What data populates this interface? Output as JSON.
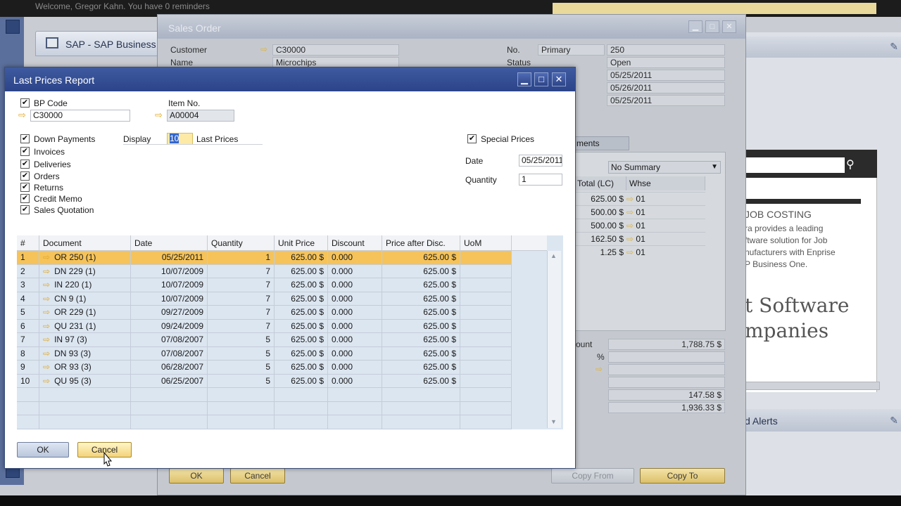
{
  "background": {
    "greeting": "Welcome, Gregor Kahn. You have 0 reminders",
    "main_window_title": "SAP - SAP Business One",
    "ad": {
      "heading": "JOB COSTING",
      "lines": [
        "ra provides a leading",
        "ftware solution for Job",
        "nufacturers with Enprise",
        "P Business One."
      ],
      "big_lines": [
        "t Software",
        "mpanies"
      ]
    },
    "alerts_title": "d Alerts"
  },
  "sales_order": {
    "title": "Sales Order",
    "customer_label": "Customer",
    "customer_value": "C30000",
    "name_label": "Name",
    "name_value": "Microchips",
    "no_label": "No.",
    "no_series": "Primary",
    "no_value": "250",
    "status_label": "Status",
    "status_value": "Open",
    "dates": [
      "05/25/2011",
      "05/26/2011",
      "05/25/2011"
    ],
    "tab_label": "ments",
    "summary_option": "No Summary",
    "grid_headers": [
      "Total (LC)",
      "Whse"
    ],
    "grid_rows": [
      {
        "total": "625.00 $",
        "whse": "01"
      },
      {
        "total": "500.00 $",
        "whse": "01"
      },
      {
        "total": "500.00 $",
        "whse": "01"
      },
      {
        "total": "162.50 $",
        "whse": "01"
      },
      {
        "total": "1.25 $",
        "whse": "01"
      }
    ],
    "totals_label": "ount",
    "totals_values": [
      "1,788.75 $",
      "147.58 $",
      "1,936.33 $"
    ],
    "percent_sign": "%",
    "ok_label": "OK",
    "cancel_label": "Cancel",
    "copy_from_label": "Copy From",
    "copy_to_label": "Copy To"
  },
  "dialog": {
    "title": "Last Prices Report",
    "bp_code_label": "BP Code",
    "bp_code_value": "C30000",
    "item_no_label": "Item No.",
    "item_no_value": "A00004",
    "doc_types": [
      "Down Payments",
      "Invoices",
      "Deliveries",
      "Orders",
      "Returns",
      "Credit Memo",
      "Sales Quotation"
    ],
    "display_label": "Display",
    "display_value": "10",
    "last_prices_label": "Last Prices",
    "special_prices_label": "Special Prices",
    "date_label": "Date",
    "date_value": "05/25/2011",
    "quantity_label": "Quantity",
    "quantity_value": "1",
    "table": {
      "headers": [
        "#",
        "Document",
        "Date",
        "Quantity",
        "Unit Price",
        "Discount",
        "Price after Disc.",
        "UoM"
      ],
      "rows": [
        [
          "1",
          "OR 250 (1)",
          "05/25/2011",
          "1",
          "625.00 $",
          "0.000",
          "625.00 $",
          ""
        ],
        [
          "2",
          "DN 229 (1)",
          "10/07/2009",
          "7",
          "625.00 $",
          "0.000",
          "625.00 $",
          ""
        ],
        [
          "3",
          "IN 220 (1)",
          "10/07/2009",
          "7",
          "625.00 $",
          "0.000",
          "625.00 $",
          ""
        ],
        [
          "4",
          "CN 9 (1)",
          "10/07/2009",
          "7",
          "625.00 $",
          "0.000",
          "625.00 $",
          ""
        ],
        [
          "5",
          "OR 229 (1)",
          "09/27/2009",
          "7",
          "625.00 $",
          "0.000",
          "625.00 $",
          ""
        ],
        [
          "6",
          "QU 231 (1)",
          "09/24/2009",
          "7",
          "625.00 $",
          "0.000",
          "625.00 $",
          ""
        ],
        [
          "7",
          "IN 97 (3)",
          "07/08/2007",
          "5",
          "625.00 $",
          "0.000",
          "625.00 $",
          ""
        ],
        [
          "8",
          "DN 93 (3)",
          "07/08/2007",
          "5",
          "625.00 $",
          "0.000",
          "625.00 $",
          ""
        ],
        [
          "9",
          "OR 93 (3)",
          "06/28/2007",
          "5",
          "625.00 $",
          "0.000",
          "625.00 $",
          ""
        ],
        [
          "10",
          "QU 95 (3)",
          "06/25/2007",
          "5",
          "625.00 $",
          "0.000",
          "625.00 $",
          ""
        ]
      ],
      "selected_row": 0
    },
    "ok_label": "OK",
    "cancel_label": "Cancel"
  },
  "icons": {
    "link_arrow": "golden-arrow-icon",
    "check": "✔",
    "minimize": "minimize-icon",
    "maximize": "maximize-icon",
    "close": "close-icon"
  },
  "colors": {
    "dialog_title": "#2c4489",
    "selected_row": "#f5c35a",
    "link_arrow": "#e2a826"
  }
}
